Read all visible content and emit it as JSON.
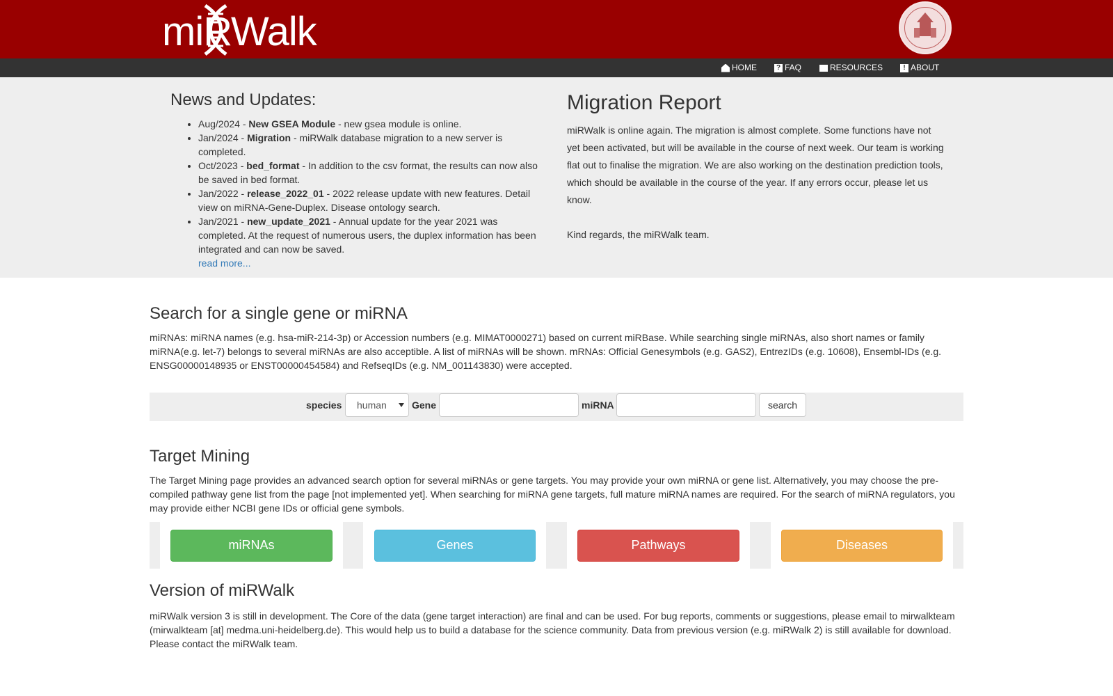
{
  "header": {
    "logo_text": "miRWalk",
    "seal": "university-seal"
  },
  "nav": [
    {
      "icon": "home-icon",
      "label": "HOME"
    },
    {
      "icon": "question-icon",
      "label": "FAQ"
    },
    {
      "icon": "resources-icon",
      "label": "RESOURCES"
    },
    {
      "icon": "exclamation-icon",
      "label": "ABOUT"
    }
  ],
  "news": {
    "title": "News and Updates:",
    "items": [
      {
        "date": "Aug/2024 - ",
        "head": "New GSEA Module",
        "text": " - new gsea module is online."
      },
      {
        "date": "Jan/2024 - ",
        "head": "Migration",
        "text": " - miRWalk database migration to a new server is completed."
      },
      {
        "date": "Oct/2023 - ",
        "head": "bed_format",
        "text": " - In addition to the csv format, the results can now also be saved in bed format."
      },
      {
        "date": "Jan/2022 - ",
        "head": "release_2022_01",
        "text": " - 2022 release update with new features. Detail view on miRNA-Gene-Duplex. Disease ontology search."
      },
      {
        "date": "Jan/2021 - ",
        "head": "new_update_2021",
        "text": " - Annual update for the year 2021 was completed. At the request of numerous users, the duplex information has been integrated and can now be saved."
      }
    ],
    "read_more": "read more..."
  },
  "migration": {
    "title": "Migration Report",
    "text": "miRWalk is online again. The migration is almost complete. Some functions have not yet been activated, but will be available in the course of next week. Our team is working flat out to finalise the migration. We are also working on the destination prediction tools, which should be available in the course of the year. If any errors occur, please let us know.",
    "regards": "Kind regards, the miRWalk team."
  },
  "search": {
    "title": "Search for a single gene or miRNA",
    "description": "miRNAs: miRNA names (e.g. hsa-miR-214-3p) or Accession numbers (e.g. MIMAT0000271) based on current miRBase. While searching single miRNAs, also short names or family miRNA(e.g. let-7) belongs to several miRNAs are also acceptible. A list of miRNAs will be shown. mRNAs: Official Genesymbols (e.g. GAS2), EntrezIDs (e.g. 10608), Ensembl-IDs (e.g. ENSG00000148935 or ENST00000454584) and RefseqIDs (e.g. NM_001143830) were accepted.",
    "species_label": "species",
    "species_value": "human",
    "gene_label": "Gene",
    "gene_value": "",
    "mirna_label": "miRNA",
    "mirna_value": "",
    "button": "search"
  },
  "mining": {
    "title": "Target Mining",
    "description": "The Target Mining page provides an advanced search option for several miRNAs or gene targets. You may provide your own miRNA or gene list. Alternatively, you may choose the pre-compiled pathway gene list from the page [not implemented yet]. When searching for miRNA gene targets, full mature miRNA names are required. For the search of miRNA regulators, you may provide either NCBI gene IDs or official gene symbols.",
    "buttons": [
      "miRNAs",
      "Genes",
      "Pathways",
      "Diseases"
    ],
    "colors": [
      "#5cb85c",
      "#5bc0de",
      "#d9534f",
      "#f0ad4e"
    ]
  },
  "version": {
    "title": "Version of miRWalk",
    "text": "miRWalk version 3 is still in development. The Core of the data (gene target interaction) are final and can be used. For bug reports, comments or suggestions, please email to mirwalkteam (mirwalkteam [at] medma.uni-heidelberg.de). This would help us to build a database for the science community. Data from previous version (e.g. miRWalk 2) is still available for download. Please contact the miRWalk team."
  },
  "colors": {
    "banner": "#990000",
    "navbar": "#333333",
    "band": "#eeeeee",
    "link": "#337ab7"
  }
}
